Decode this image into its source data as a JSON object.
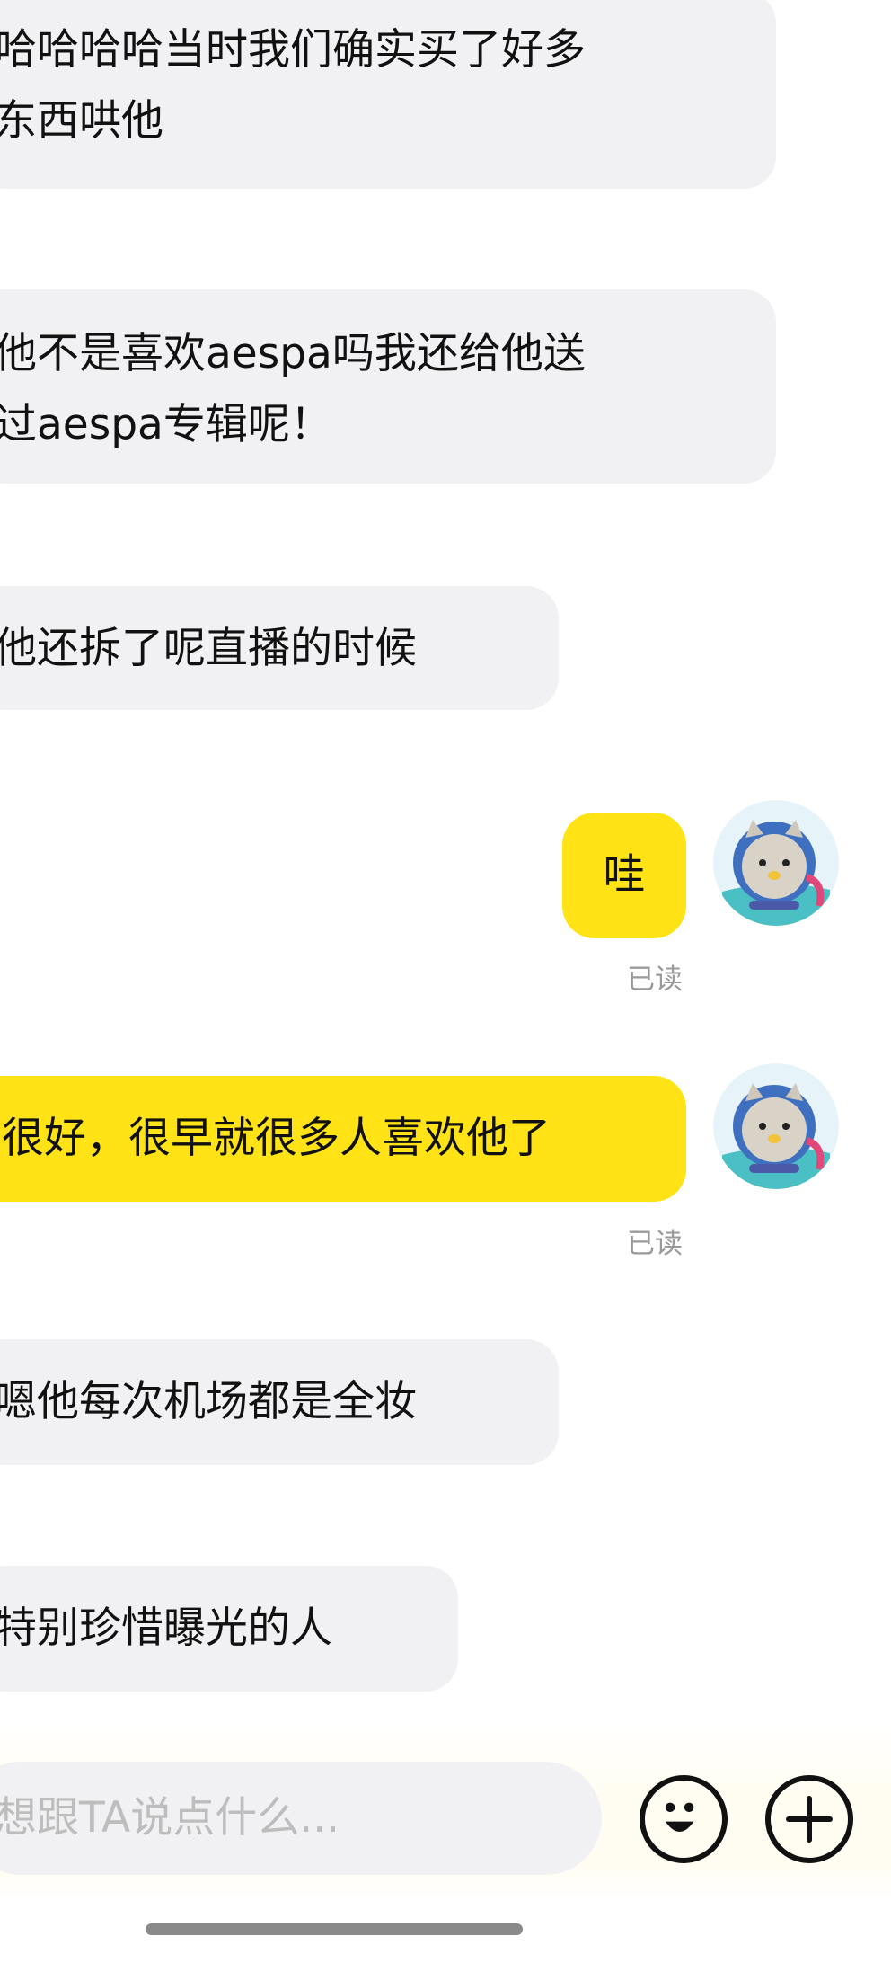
{
  "messages": [
    {
      "side": "incoming",
      "text": "哈哈哈哈当时我们确实买了好多\n东西哄他"
    },
    {
      "side": "incoming",
      "text": "他不是喜欢aespa吗我还给他送\n过aespa专辑呢！"
    },
    {
      "side": "incoming",
      "text": "他还拆了呢直播的时候"
    },
    {
      "side": "outgoing",
      "text": "哇",
      "status": "已读"
    },
    {
      "side": "outgoing",
      "text": "很好，很早就很多人喜欢他了",
      "status": "已读"
    },
    {
      "side": "incoming",
      "text": "嗯他每次机场都是全妆"
    },
    {
      "side": "incoming",
      "text": "特别珍惜曝光的人"
    }
  ],
  "composer": {
    "placeholder": "想跟TA说点什么...",
    "emoji_icon": "emoji-icon",
    "add_icon": "plus-icon"
  },
  "colors": {
    "incoming_bubble": "#f1f1f3",
    "outgoing_bubble": "#ffe316",
    "read_status": "#9a9a9a"
  }
}
